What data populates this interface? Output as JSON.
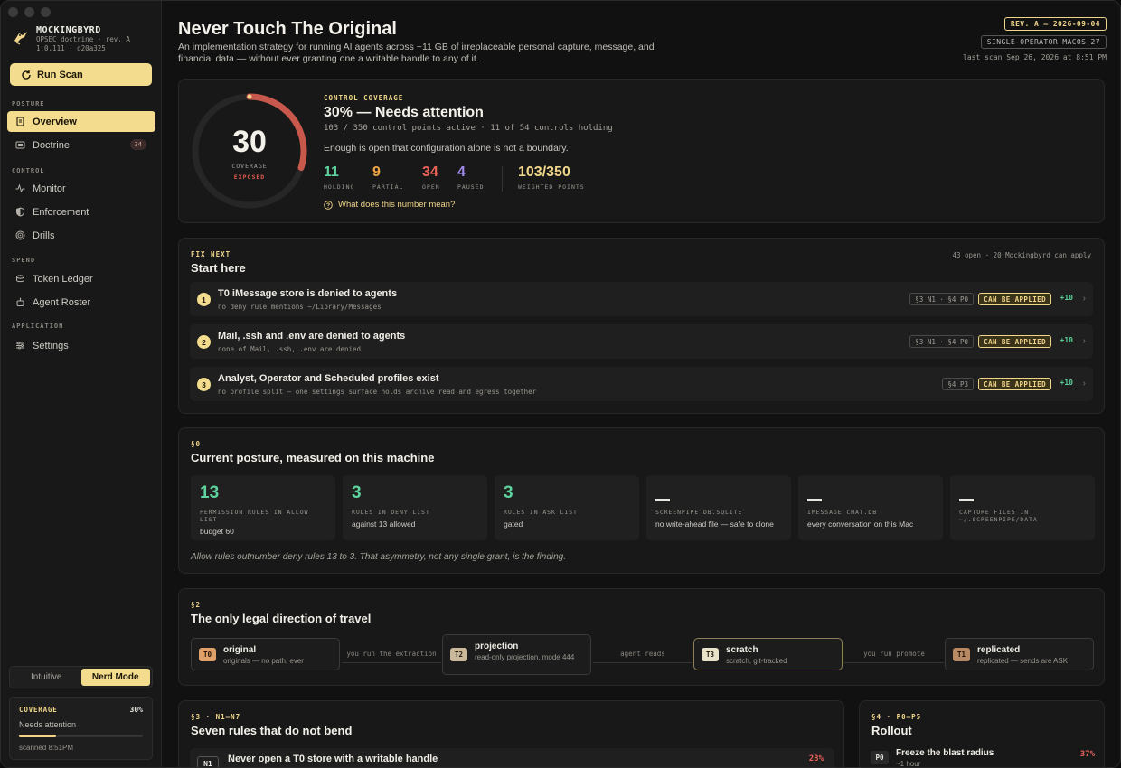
{
  "app": {
    "name": "MOCKINGBYRD",
    "doctrine": "OPSEC doctrine · rev. A",
    "version": "1.0.111 · d20a325",
    "run_scan": "Run Scan"
  },
  "nav": {
    "posture_label": "POSTURE",
    "overview": "Overview",
    "doctrine": "Doctrine",
    "doctrine_badge": "34",
    "control_label": "CONTROL",
    "monitor": "Monitor",
    "enforcement": "Enforcement",
    "drills": "Drills",
    "spend_label": "SPEND",
    "token_ledger": "Token Ledger",
    "agent_roster": "Agent Roster",
    "application_label": "APPLICATION",
    "settings": "Settings"
  },
  "mode": {
    "intuitive": "Intuitive",
    "nerd": "Nerd Mode"
  },
  "sidebar_coverage": {
    "title": "COVERAGE",
    "percent": "30%",
    "status": "Needs attention",
    "scanned": "scanned 8:51PM",
    "fill": 0.3
  },
  "header": {
    "title": "Never Touch The Original",
    "subtitle": "An implementation strategy for running AI agents across ~11 GB of irreplaceable personal capture, message, and financial data — without ever granting one a writable handle to any of it.",
    "rev": "REV. A — 2026-09-04",
    "os": "SINGLE-OPERATOR MACOS 27",
    "last_scan": "last scan Sep 26, 2026 at 8:51 PM"
  },
  "coverage": {
    "score": "30",
    "gauge_label": "COVERAGE",
    "gauge_status": "EXPOSED",
    "fraction": 0.3,
    "eyebrow": "CONTROL COVERAGE",
    "headline": "30% — Needs attention",
    "detail": "103 / 350 control points active · 11 of 54 controls holding",
    "note": "Enough is open that configuration alone is not a boundary.",
    "stats": [
      {
        "value": "11",
        "label": "HOLDING",
        "color": "#5fd39e"
      },
      {
        "value": "9",
        "label": "PARTIAL",
        "color": "#f0a64a"
      },
      {
        "value": "34",
        "label": "OPEN",
        "color": "#e8645a"
      },
      {
        "value": "4",
        "label": "PAUSED",
        "color": "#a08be8"
      }
    ],
    "weighted_value": "103/350",
    "weighted_label": "WEIGHTED POINTS",
    "help_link": "What does this number mean?"
  },
  "fix_next": {
    "eyebrow": "FIX NEXT",
    "title": "Start here",
    "summary": "43 open · 20 Mockingbyrd can apply",
    "items": [
      {
        "num": "1",
        "title": "T0 iMessage store is denied to agents",
        "sub": "no deny rule mentions ~/Library/Messages",
        "tag": "§3 N1 · §4 P0",
        "apply": "CAN BE APPLIED",
        "plus": "+10"
      },
      {
        "num": "2",
        "title": "Mail, .ssh and .env are denied to agents",
        "sub": "none of Mail, .ssh, .env are denied",
        "tag": "§3 N1 · §4 P0",
        "apply": "CAN BE APPLIED",
        "plus": "+10"
      },
      {
        "num": "3",
        "title": "Analyst, Operator and Scheduled profiles exist",
        "sub": "no profile split — one settings surface holds archive read and egress together",
        "tag": "§4 P3",
        "apply": "CAN BE APPLIED",
        "plus": "+10"
      }
    ]
  },
  "posture": {
    "eyebrow": "§0",
    "title": "Current posture, measured on this machine",
    "cards": [
      {
        "value": "13",
        "label": "PERMISSION RULES IN ALLOW LIST",
        "desc": "budget 60"
      },
      {
        "value": "3",
        "label": "RULES IN DENY LIST",
        "desc": "against 13 allowed"
      },
      {
        "value": "3",
        "label": "RULES IN ASK LIST",
        "desc": "gated"
      },
      {
        "value": "",
        "label": "SCREENPIPE DB.SQLITE",
        "desc": "no write-ahead file — safe to clone"
      },
      {
        "value": "",
        "label": "IMESSAGE CHAT.DB",
        "desc": "every conversation on this Mac"
      },
      {
        "value": "",
        "label": "CAPTURE FILES IN ~/.SCREENPIPE/DATA",
        "desc": ""
      }
    ],
    "footnote": "Allow rules outnumber deny rules 13 to 3. That asymmetry, not any single grant, is the finding."
  },
  "direction": {
    "eyebrow": "§2",
    "title": "The only legal direction of travel",
    "tiers": [
      {
        "badge": "T0",
        "name": "original",
        "desc": "originals — no path, ever"
      },
      {
        "badge": "T2",
        "name": "projection",
        "desc": "read-only projection, mode 444"
      },
      {
        "badge": "T3",
        "name": "scratch",
        "desc": "scratch, git-tracked"
      },
      {
        "badge": "T1",
        "name": "replicated",
        "desc": "replicated — sends are ASK"
      }
    ],
    "arrows": [
      "you run the extraction",
      "agent reads",
      "you run promote"
    ]
  },
  "rules": {
    "eyebrow": "§3 · N1–N7",
    "title": "Seven rules that do not bend",
    "first": {
      "code": "N1",
      "title": "Never open a T0 store with a writable handle",
      "pct": "28%"
    }
  },
  "rollout": {
    "eyebrow": "§4 · P0–P5",
    "title": "Rollout",
    "first": {
      "code": "P0",
      "title": "Freeze the blast radius",
      "sub": "~1 hour",
      "pct": "37%"
    }
  }
}
